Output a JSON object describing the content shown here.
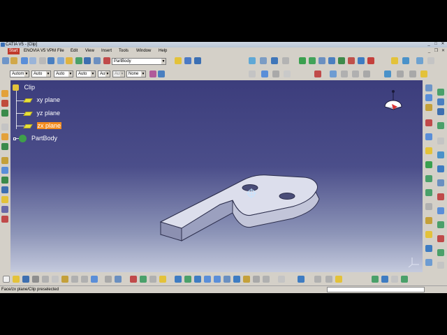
{
  "window": {
    "title": "CATIA V5 - [Clip]"
  },
  "menu": [
    {
      "label": "Start",
      "active": true
    },
    {
      "label": "ENOVIA V5 VPM"
    },
    {
      "label": "File"
    },
    {
      "label": "Edit"
    },
    {
      "label": "View"
    },
    {
      "label": "Insert"
    },
    {
      "label": "Tools"
    },
    {
      "label": "Window"
    },
    {
      "label": "Help"
    }
  ],
  "toolbar": {
    "body_select": "PartBody"
  },
  "properties_toolbar": {
    "line_type": "Autom",
    "color": "Auto",
    "line_weight": "Auto",
    "layer": "Auto",
    "point_type": "Aut",
    "transparency": "Aut",
    "layer_filter": "None"
  },
  "tree": {
    "root": "Clip",
    "items": [
      {
        "label": "xy plane",
        "selected": false
      },
      {
        "label": "yz plane",
        "selected": false
      },
      {
        "label": "zx plane",
        "selected": true
      },
      {
        "label": "PartBody",
        "selected": false
      }
    ]
  },
  "status": {
    "message": "Face/zx plane/Clip preselected"
  },
  "colors": {
    "selection": "#f28b1e",
    "viewport_top": "#3c3d7c",
    "viewport_bottom": "#c4cadd",
    "chrome": "#d4d0c8"
  }
}
